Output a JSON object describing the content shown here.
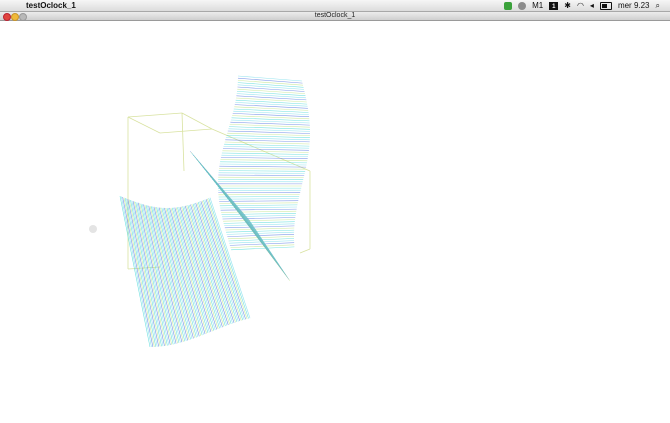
{
  "menubar": {
    "apple_glyph": "",
    "app_name": "testOclock_1",
    "tray": {
      "mail_count": "1",
      "badge": "1",
      "clock": "mer 9.23"
    }
  },
  "window": {
    "title": "testOclock_1"
  },
  "scene": {
    "ribbon_colors": [
      "#3fd6d6",
      "#6ad8e8",
      "#4b6fe0",
      "#b7e07a"
    ],
    "box_color": "#d8e2a0",
    "cursor_color": "#e4e4e4"
  }
}
